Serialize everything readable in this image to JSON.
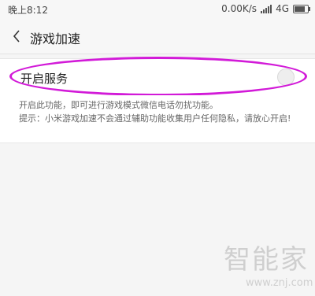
{
  "status_bar": {
    "time": "晚上8:12",
    "network_speed": "0.00K/s",
    "network_type": "4G"
  },
  "header": {
    "back_icon": "chevron-left-icon",
    "title": "游戏加速"
  },
  "service": {
    "label": "开启服务",
    "toggle_state": "off"
  },
  "description": {
    "line1": "开启此功能，即可进行游戏模式微信电话勿扰功能。",
    "line2": "提示：小米游戏加速不会通过辅助功能收集用户任何隐私，请放心开启!"
  },
  "watermark": {
    "logo": "智能家",
    "url": "www.znj.com"
  },
  "colors": {
    "highlight": "#d21ad8",
    "background": "#f5f5f5",
    "card": "#ffffff"
  }
}
